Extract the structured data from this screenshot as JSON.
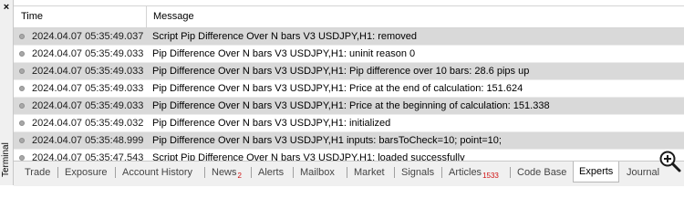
{
  "side": {
    "close_glyph": "×",
    "label": "Terminal"
  },
  "header": {
    "time": "Time",
    "message": "Message"
  },
  "rows": [
    {
      "time": "2024.04.07 05:35:49.037",
      "message": "Script Pip Difference Over N bars V3 USDJPY,H1: removed",
      "selected": true
    },
    {
      "time": "2024.04.07 05:35:49.033",
      "message": "Pip Difference Over N bars V3 USDJPY,H1: uninit reason 0",
      "selected": false
    },
    {
      "time": "2024.04.07 05:35:49.033",
      "message": "Pip Difference Over N bars V3 USDJPY,H1: Pip difference over 10 bars: 28.6 pips up",
      "selected": true
    },
    {
      "time": "2024.04.07 05:35:49.033",
      "message": "Pip Difference Over N bars V3 USDJPY,H1: Price at the end of calculation: 151.624",
      "selected": false
    },
    {
      "time": "2024.04.07 05:35:49.033",
      "message": "Pip Difference Over N bars V3 USDJPY,H1: Price at the beginning of calculation: 151.338",
      "selected": true
    },
    {
      "time": "2024.04.07 05:35:49.032",
      "message": "Pip Difference Over N bars V3 USDJPY,H1: initialized",
      "selected": false
    },
    {
      "time": "2024.04.07 05:35:48.999",
      "message": "Pip Difference Over N bars V3 USDJPY,H1 inputs: barsToCheck=10; point=10;",
      "selected": true
    },
    {
      "time": "2024.04.07 05:35:47.543",
      "message": "Script Pip Difference Over N bars V3 USDJPY,H1: loaded successfully",
      "selected": false
    }
  ],
  "tabs": [
    {
      "label": "Trade",
      "badge": ""
    },
    {
      "label": "Exposure",
      "badge": ""
    },
    {
      "label": "Account History",
      "badge": ""
    },
    {
      "label": "News",
      "badge": "2"
    },
    {
      "label": "Alerts",
      "badge": ""
    },
    {
      "label": "Mailbox",
      "badge": ""
    },
    {
      "label": "Market",
      "badge": ""
    },
    {
      "label": "Signals",
      "badge": ""
    },
    {
      "label": "Articles",
      "badge": "1533"
    },
    {
      "label": "Code Base",
      "badge": ""
    },
    {
      "label": "Experts",
      "badge": "",
      "active": true
    },
    {
      "label": "Journal",
      "badge": ""
    }
  ],
  "colors": {
    "selected_row": "#d9d9d9",
    "badge": "#d01010",
    "tabbar": "#f0f0f0"
  },
  "icons": {
    "row_status": "gray-dot-icon",
    "zoom": "magnifier-plus-icon"
  }
}
